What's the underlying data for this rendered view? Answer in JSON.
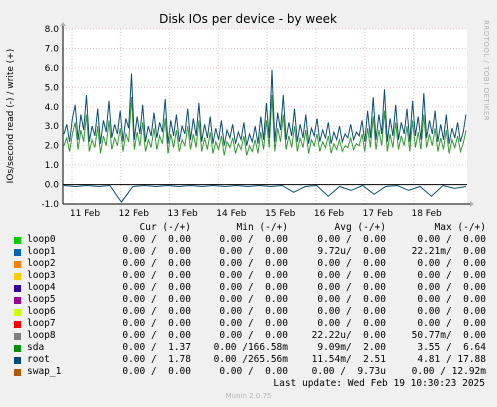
{
  "chart_data": {
    "type": "line",
    "title": "Disk IOs per device - by week",
    "ylabel": "IOs/second read (-) / write (+)",
    "side_text": "RRDTOOL / TOBI OETIKER",
    "ylim": [
      -1.0,
      8.0
    ],
    "y_ticks": [
      "8.0",
      "7.0",
      "6.0",
      "5.0",
      "4.0",
      "3.0",
      "2.0",
      "1.0",
      "0.0",
      "-1.0"
    ],
    "x_ticks": [
      "11 Feb",
      "12 Feb",
      "13 Feb",
      "14 Feb",
      "15 Feb",
      "16 Feb",
      "17 Feb",
      "18 Feb"
    ],
    "grid": true,
    "series": [
      {
        "name": "root",
        "color": "#0b4e72",
        "values": [
          2.6,
          3.1,
          2.2,
          3.4,
          4.1,
          2.3,
          3.6,
          2.8,
          4.6,
          2.2,
          3.0,
          2.5,
          3.9,
          2.1,
          3.3,
          2.7,
          4.3,
          2.4,
          3.1,
          2.6,
          3.8,
          2.2,
          3.4,
          2.9,
          5.7,
          2.3,
          3.5,
          2.6,
          4.1,
          2.2,
          3.0,
          2.5,
          3.7,
          2.4,
          3.2,
          2.7,
          4.4,
          2.1,
          3.3,
          2.5,
          3.6,
          2.2,
          3.0,
          2.6,
          3.9,
          2.3,
          3.4,
          2.5,
          4.2,
          2.2,
          3.1,
          2.4,
          3.5,
          2.1,
          2.9,
          2.3,
          3.3,
          2.0,
          2.8,
          2.4,
          3.1,
          2.1,
          2.7,
          2.3,
          3.2,
          2.0,
          2.6,
          2.2,
          3.0,
          2.1,
          3.5,
          2.3,
          4.2,
          2.4,
          5.9,
          2.2,
          3.7,
          2.8,
          4.6,
          2.3,
          3.2,
          2.5,
          3.9,
          2.2,
          3.1,
          2.4,
          3.6,
          2.1,
          2.9,
          2.5,
          3.4,
          2.2,
          2.8,
          2.4,
          3.2,
          2.1,
          2.7,
          2.3,
          3.0,
          2.2,
          2.6,
          2.4,
          3.1,
          2.3,
          2.7,
          2.5,
          3.3,
          2.2,
          3.8,
          2.4,
          4.5,
          2.3,
          3.6,
          2.6,
          4.9,
          2.2,
          3.4,
          2.5,
          4.1,
          2.3,
          3.2,
          2.6,
          3.9,
          2.2,
          4.3,
          2.5,
          3.5,
          2.3,
          4.7,
          2.4,
          3.3,
          2.6,
          3.8,
          2.2,
          3.1,
          2.3,
          3.6,
          2.1,
          2.9,
          2.4,
          3.2,
          2.2,
          2.7,
          3.6
        ],
        "read_dips": [
          -0.05,
          -0.1,
          -0.05,
          -0.1,
          -0.05,
          -0.9,
          -0.1,
          -0.05,
          -0.1,
          -0.05,
          -0.1,
          -0.05,
          -0.1,
          -0.05,
          -0.1,
          -0.05,
          -0.1,
          -0.05,
          -0.1,
          -0.05,
          -0.4,
          -0.1,
          -0.05,
          -0.6,
          -0.1,
          -0.3,
          -0.05,
          -0.5,
          -0.1,
          -0.05,
          -0.3,
          -0.1,
          -0.6,
          -0.05,
          -0.2,
          -0.1
        ]
      },
      {
        "name": "sda",
        "color": "#339933",
        "values": [
          2.0,
          2.4,
          1.7,
          2.6,
          3.2,
          1.8,
          2.8,
          2.2,
          3.6,
          1.7,
          2.3,
          1.9,
          3.0,
          1.6,
          2.5,
          2.0,
          3.3,
          1.8,
          2.4,
          2.0,
          2.9,
          1.7,
          2.6,
          2.2,
          4.5,
          1.8,
          2.7,
          2.0,
          3.2,
          1.7,
          2.3,
          1.9,
          2.9,
          1.8,
          2.5,
          2.1,
          3.4,
          1.6,
          2.6,
          1.9,
          2.8,
          1.7,
          2.3,
          2.0,
          3.0,
          1.8,
          2.6,
          1.9,
          3.3,
          1.7,
          2.4,
          1.8,
          2.7,
          1.6,
          2.2,
          1.8,
          2.5,
          1.5,
          2.2,
          1.9,
          2.4,
          1.6,
          2.1,
          1.8,
          2.5,
          1.5,
          2.0,
          1.7,
          2.3,
          1.6,
          2.7,
          1.8,
          3.3,
          1.9,
          4.6,
          1.7,
          2.9,
          2.2,
          3.6,
          1.8,
          2.5,
          1.9,
          3.0,
          1.7,
          2.4,
          1.9,
          2.8,
          1.6,
          2.3,
          2.0,
          2.6,
          1.7,
          2.2,
          1.9,
          2.5,
          1.6,
          2.1,
          1.8,
          2.3,
          1.7,
          2.0,
          1.9,
          2.4,
          1.8,
          2.1,
          2.0,
          2.6,
          1.7,
          2.9,
          1.9,
          3.5,
          1.8,
          2.8,
          2.0,
          3.8,
          1.7,
          2.6,
          1.9,
          3.2,
          1.8,
          2.5,
          2.0,
          3.0,
          1.7,
          3.3,
          1.9,
          2.7,
          1.8,
          3.6,
          1.9,
          2.6,
          2.0,
          2.9,
          1.7,
          2.4,
          1.8,
          2.8,
          1.6,
          2.3,
          1.9,
          2.5,
          1.7,
          2.1,
          2.8
        ]
      }
    ]
  },
  "legend": {
    "headers": {
      "cur": "Cur (-/+)",
      "min": "Min (-/+)",
      "avg": "Avg (-/+)",
      "max": "Max (-/+)"
    },
    "rows": [
      {
        "name": "loop0",
        "color": "#00cc00",
        "cur": "0.00 /  0.00",
        "min": "0.00 /  0.00",
        "avg": "0.00 /  0.00",
        "max": "0.00 /  0.00"
      },
      {
        "name": "loop1",
        "color": "#0066b3",
        "cur": "0.00 /  0.00",
        "min": "0.00 /  0.00",
        "avg": "9.72u/  0.00",
        "max": "22.21m/  0.00"
      },
      {
        "name": "loop2",
        "color": "#ff8000",
        "cur": "0.00 /  0.00",
        "min": "0.00 /  0.00",
        "avg": "0.00 /  0.00",
        "max": "0.00 /  0.00"
      },
      {
        "name": "loop3",
        "color": "#ffcc00",
        "cur": "0.00 /  0.00",
        "min": "0.00 /  0.00",
        "avg": "0.00 /  0.00",
        "max": "0.00 /  0.00"
      },
      {
        "name": "loop4",
        "color": "#330099",
        "cur": "0.00 /  0.00",
        "min": "0.00 /  0.00",
        "avg": "0.00 /  0.00",
        "max": "0.00 /  0.00"
      },
      {
        "name": "loop5",
        "color": "#990099",
        "cur": "0.00 /  0.00",
        "min": "0.00 /  0.00",
        "avg": "0.00 /  0.00",
        "max": "0.00 /  0.00"
      },
      {
        "name": "loop6",
        "color": "#ccff00",
        "cur": "0.00 /  0.00",
        "min": "0.00 /  0.00",
        "avg": "0.00 /  0.00",
        "max": "0.00 /  0.00"
      },
      {
        "name": "loop7",
        "color": "#ff0000",
        "cur": "0.00 /  0.00",
        "min": "0.00 /  0.00",
        "avg": "0.00 /  0.00",
        "max": "0.00 /  0.00"
      },
      {
        "name": "loop8",
        "color": "#808080",
        "cur": "0.00 /  0.00",
        "min": "0.00 /  0.00",
        "avg": "22.22u/  0.00",
        "max": "50.77m/  0.00"
      },
      {
        "name": "sda",
        "color": "#008f00",
        "cur": "0.00 /  1.37",
        "min": "0.00 /166.58m",
        "avg": "9.09m/  2.00",
        "max": "3.55 /  6.64"
      },
      {
        "name": "root",
        "color": "#00487d",
        "cur": "0.00 /  1.78",
        "min": "0.00 /265.56m",
        "avg": "11.54m/  2.51",
        "max": "4.81 / 17.88"
      },
      {
        "name": "swap_1",
        "color": "#b35a00",
        "cur": "0.00 /  0.00",
        "min": "0.00 /  0.00",
        "avg": "0.00 /  9.73u",
        "max": "0.00 / 12.92m"
      }
    ]
  },
  "last_update": "Last update: Wed Feb 19 10:30:23 2025",
  "munin_version": "Munin 2.0.75"
}
